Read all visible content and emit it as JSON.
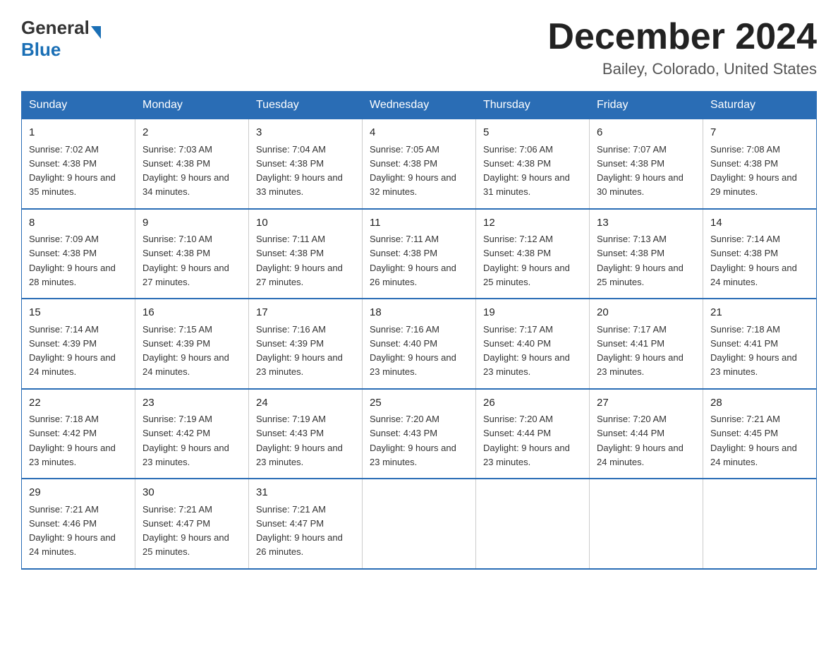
{
  "header": {
    "logo_general": "General",
    "logo_blue": "Blue",
    "month_title": "December 2024",
    "location": "Bailey, Colorado, United States"
  },
  "days_of_week": [
    "Sunday",
    "Monday",
    "Tuesday",
    "Wednesday",
    "Thursday",
    "Friday",
    "Saturday"
  ],
  "weeks": [
    [
      {
        "day": "1",
        "sunrise": "7:02 AM",
        "sunset": "4:38 PM",
        "daylight": "9 hours and 35 minutes."
      },
      {
        "day": "2",
        "sunrise": "7:03 AM",
        "sunset": "4:38 PM",
        "daylight": "9 hours and 34 minutes."
      },
      {
        "day": "3",
        "sunrise": "7:04 AM",
        "sunset": "4:38 PM",
        "daylight": "9 hours and 33 minutes."
      },
      {
        "day": "4",
        "sunrise": "7:05 AM",
        "sunset": "4:38 PM",
        "daylight": "9 hours and 32 minutes."
      },
      {
        "day": "5",
        "sunrise": "7:06 AM",
        "sunset": "4:38 PM",
        "daylight": "9 hours and 31 minutes."
      },
      {
        "day": "6",
        "sunrise": "7:07 AM",
        "sunset": "4:38 PM",
        "daylight": "9 hours and 30 minutes."
      },
      {
        "day": "7",
        "sunrise": "7:08 AM",
        "sunset": "4:38 PM",
        "daylight": "9 hours and 29 minutes."
      }
    ],
    [
      {
        "day": "8",
        "sunrise": "7:09 AM",
        "sunset": "4:38 PM",
        "daylight": "9 hours and 28 minutes."
      },
      {
        "day": "9",
        "sunrise": "7:10 AM",
        "sunset": "4:38 PM",
        "daylight": "9 hours and 27 minutes."
      },
      {
        "day": "10",
        "sunrise": "7:11 AM",
        "sunset": "4:38 PM",
        "daylight": "9 hours and 27 minutes."
      },
      {
        "day": "11",
        "sunrise": "7:11 AM",
        "sunset": "4:38 PM",
        "daylight": "9 hours and 26 minutes."
      },
      {
        "day": "12",
        "sunrise": "7:12 AM",
        "sunset": "4:38 PM",
        "daylight": "9 hours and 25 minutes."
      },
      {
        "day": "13",
        "sunrise": "7:13 AM",
        "sunset": "4:38 PM",
        "daylight": "9 hours and 25 minutes."
      },
      {
        "day": "14",
        "sunrise": "7:14 AM",
        "sunset": "4:38 PM",
        "daylight": "9 hours and 24 minutes."
      }
    ],
    [
      {
        "day": "15",
        "sunrise": "7:14 AM",
        "sunset": "4:39 PM",
        "daylight": "9 hours and 24 minutes."
      },
      {
        "day": "16",
        "sunrise": "7:15 AM",
        "sunset": "4:39 PM",
        "daylight": "9 hours and 24 minutes."
      },
      {
        "day": "17",
        "sunrise": "7:16 AM",
        "sunset": "4:39 PM",
        "daylight": "9 hours and 23 minutes."
      },
      {
        "day": "18",
        "sunrise": "7:16 AM",
        "sunset": "4:40 PM",
        "daylight": "9 hours and 23 minutes."
      },
      {
        "day": "19",
        "sunrise": "7:17 AM",
        "sunset": "4:40 PM",
        "daylight": "9 hours and 23 minutes."
      },
      {
        "day": "20",
        "sunrise": "7:17 AM",
        "sunset": "4:41 PM",
        "daylight": "9 hours and 23 minutes."
      },
      {
        "day": "21",
        "sunrise": "7:18 AM",
        "sunset": "4:41 PM",
        "daylight": "9 hours and 23 minutes."
      }
    ],
    [
      {
        "day": "22",
        "sunrise": "7:18 AM",
        "sunset": "4:42 PM",
        "daylight": "9 hours and 23 minutes."
      },
      {
        "day": "23",
        "sunrise": "7:19 AM",
        "sunset": "4:42 PM",
        "daylight": "9 hours and 23 minutes."
      },
      {
        "day": "24",
        "sunrise": "7:19 AM",
        "sunset": "4:43 PM",
        "daylight": "9 hours and 23 minutes."
      },
      {
        "day": "25",
        "sunrise": "7:20 AM",
        "sunset": "4:43 PM",
        "daylight": "9 hours and 23 minutes."
      },
      {
        "day": "26",
        "sunrise": "7:20 AM",
        "sunset": "4:44 PM",
        "daylight": "9 hours and 23 minutes."
      },
      {
        "day": "27",
        "sunrise": "7:20 AM",
        "sunset": "4:44 PM",
        "daylight": "9 hours and 24 minutes."
      },
      {
        "day": "28",
        "sunrise": "7:21 AM",
        "sunset": "4:45 PM",
        "daylight": "9 hours and 24 minutes."
      }
    ],
    [
      {
        "day": "29",
        "sunrise": "7:21 AM",
        "sunset": "4:46 PM",
        "daylight": "9 hours and 24 minutes."
      },
      {
        "day": "30",
        "sunrise": "7:21 AM",
        "sunset": "4:47 PM",
        "daylight": "9 hours and 25 minutes."
      },
      {
        "day": "31",
        "sunrise": "7:21 AM",
        "sunset": "4:47 PM",
        "daylight": "9 hours and 26 minutes."
      },
      null,
      null,
      null,
      null
    ]
  ]
}
